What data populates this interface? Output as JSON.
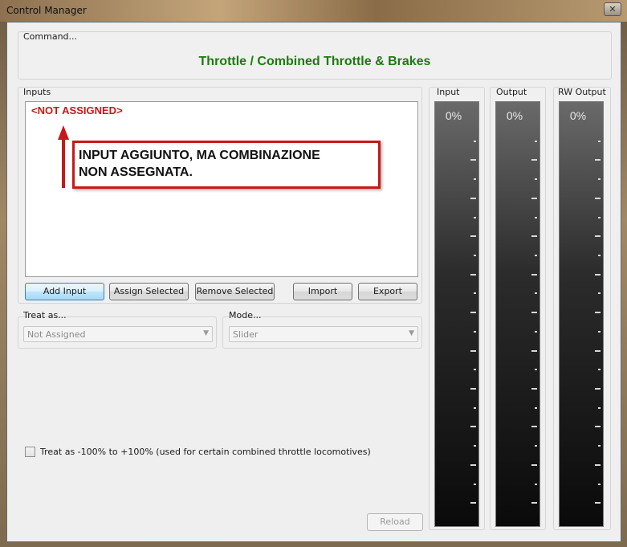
{
  "window": {
    "title": "Control Manager",
    "close_label": "✕"
  },
  "command": {
    "group_label": "Command...",
    "title": "Throttle / Combined Throttle & Brakes"
  },
  "inputs": {
    "group_label": "Inputs",
    "items": [
      "<NOT ASSIGNED>"
    ],
    "buttons": {
      "add": "Add Input",
      "assign": "Assign Selected",
      "remove": "Remove Selected",
      "import": "Import",
      "export": "Export"
    }
  },
  "treat_as": {
    "label": "Treat as...",
    "value": "Not Assigned"
  },
  "mode": {
    "label": "Mode...",
    "value": "Slider"
  },
  "checkbox": {
    "label": "Treat as -100% to +100% (used for certain combined throttle locomotives)",
    "checked": false
  },
  "reload_label": "Reload",
  "meters": [
    {
      "label": "Input",
      "value": "0%"
    },
    {
      "label": "Output",
      "value": "0%"
    },
    {
      "label": "RW Output",
      "value": "0%"
    }
  ],
  "annotation": {
    "line1": "INPUT AGGIUNTO, MA COMBINAZIONE",
    "line2": "NON ASSEGNATA.",
    "color": "#c81818"
  }
}
